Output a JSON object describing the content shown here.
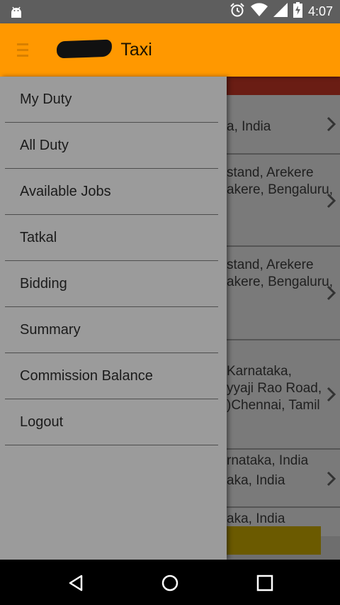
{
  "status_bar": {
    "time": "4:07",
    "icons": [
      "android-icon",
      "alarm-icon",
      "wifi-icon",
      "signal-icon",
      "battery-icon"
    ]
  },
  "toolbar": {
    "title": "Taxi",
    "redacted": true,
    "background_color": "#ff9800"
  },
  "drawer": {
    "items": [
      {
        "label": "My Duty"
      },
      {
        "label": "All Duty"
      },
      {
        "label": "Available Jobs"
      },
      {
        "label": "Tatkal"
      },
      {
        "label": "Bidding"
      },
      {
        "label": "Summary"
      },
      {
        "label": "Commission Balance"
      },
      {
        "label": "Logout"
      }
    ]
  },
  "background_list": {
    "rows": [
      {
        "lines": [
          "a, India"
        ]
      },
      {
        "lines": [
          "stand, Arekere",
          "akere, Bengaluru,"
        ]
      },
      {
        "lines": [
          "stand, Arekere",
          "akere, Bengaluru,"
        ]
      },
      {
        "lines": [
          "Karnataka,",
          "yyaji Rao Road,",
          ")Chennai, Tamil"
        ]
      },
      {
        "lines": [
          "rnataka, India",
          "aka, India"
        ]
      },
      {
        "lines": [
          "aka, India"
        ]
      }
    ]
  },
  "nav_bar": {
    "buttons": [
      "back-icon",
      "home-icon",
      "recents-icon"
    ]
  }
}
